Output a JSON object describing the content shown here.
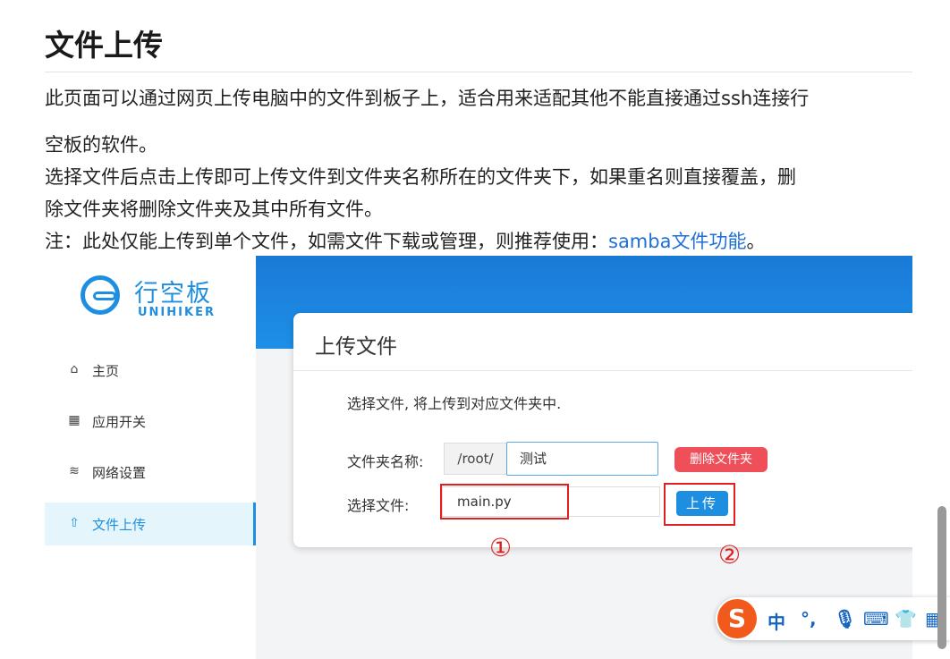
{
  "article": {
    "title": "文件上传",
    "para1_line1": "此页面可以通过网页上传电脑中的文件到板子上，适合用来适配其他不能直接通过ssh连接行",
    "para1_line2": "空板的软件。",
    "para2_line1": "选择文件后点击上传即可上传文件到文件夹名称所在的文件夹下，如果重名则直接覆盖，删",
    "para2_line2": "除文件夹将删除文件夹及其中所有文件。",
    "note_prefix": "注：此处仅能上传到单个文件，如需文件下载或管理，则推荐使用：",
    "note_link": "samba文件功能",
    "note_suffix": "。"
  },
  "app": {
    "logo_cn": "行空板",
    "logo_en": "UNIHIKER",
    "nav": [
      {
        "label": "主页",
        "icon": "home-icon"
      },
      {
        "label": "应用开关",
        "icon": "grid-icon"
      },
      {
        "label": "网络设置",
        "icon": "wifi-icon"
      },
      {
        "label": "文件上传",
        "icon": "upload-icon",
        "active": true
      }
    ],
    "card": {
      "title": "上传文件",
      "desc": "选择文件, 将上传到对应文件夹中.",
      "folder_label": "文件夹名称:",
      "folder_prefix": "/root/",
      "folder_value": "测试",
      "delete_button": "删除文件夹",
      "file_label": "选择文件:",
      "file_value": "main.py",
      "upload_button": "上传"
    },
    "annotations": {
      "marker1": "①",
      "marker2": "②"
    }
  },
  "ime": {
    "logo": "S",
    "mode": "中",
    "punct": "°,"
  },
  "colors": {
    "accent": "#1e8fe0",
    "danger": "#ef4f58",
    "annotation": "#e02020",
    "link": "#1e6fd9"
  }
}
